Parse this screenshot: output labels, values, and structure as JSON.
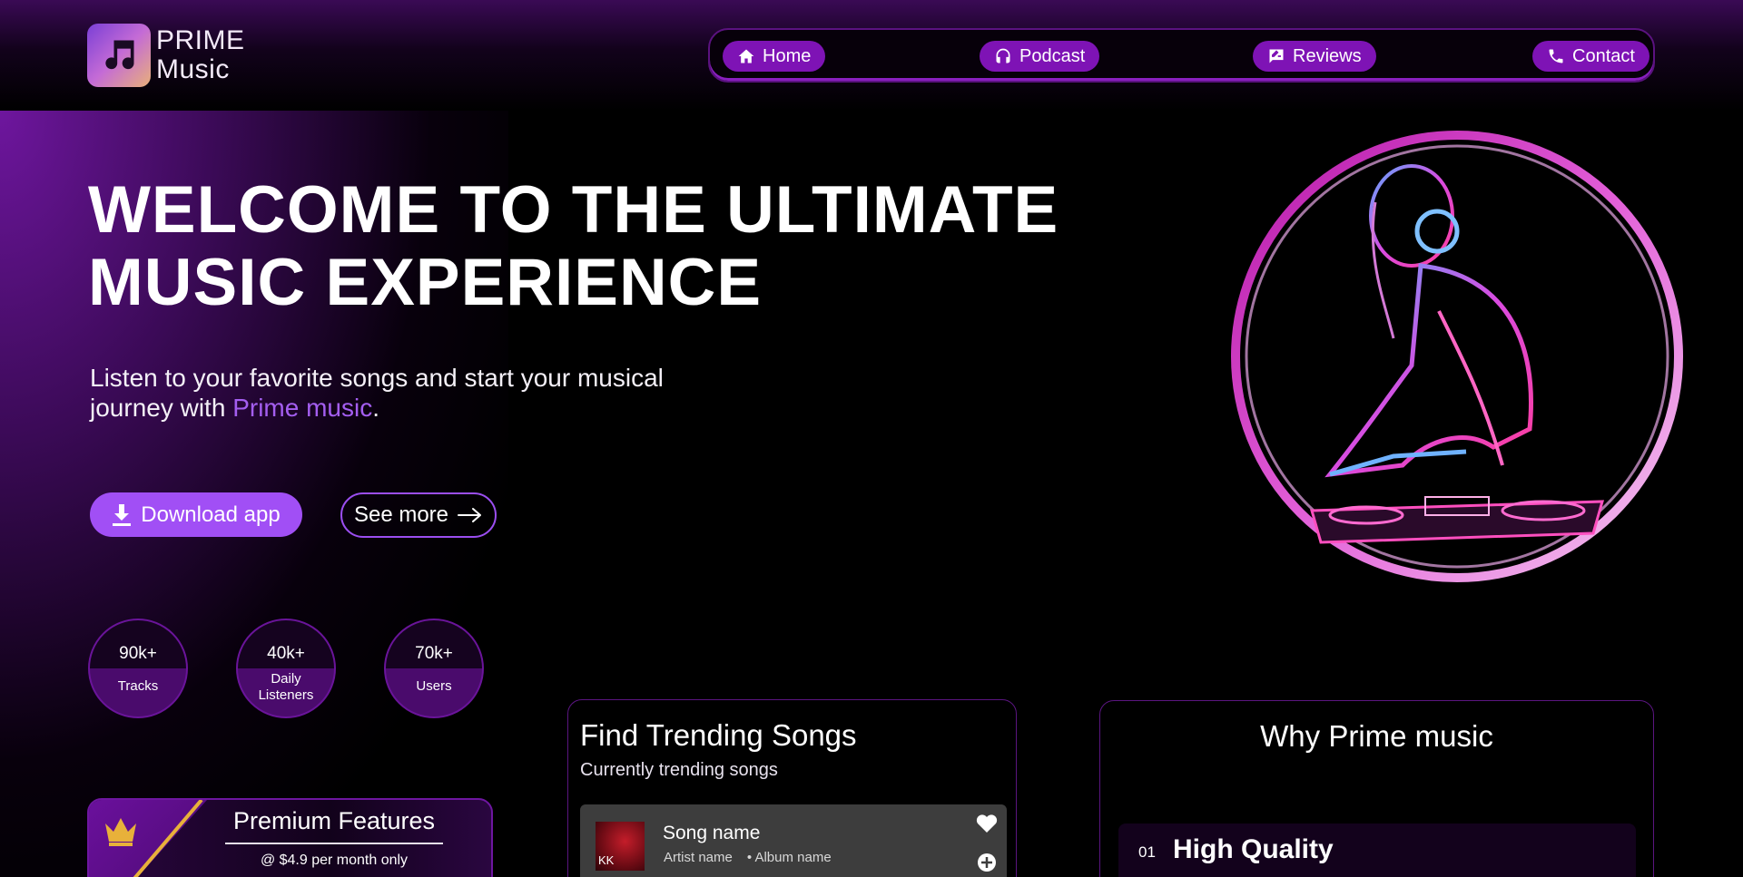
{
  "brand": {
    "line1": "PRIME",
    "line2": "Music"
  },
  "nav": [
    {
      "label": "Home",
      "icon": "home-icon"
    },
    {
      "label": "Podcast",
      "icon": "headphones-icon"
    },
    {
      "label": "Reviews",
      "icon": "review-icon"
    },
    {
      "label": "Contact",
      "icon": "phone-icon"
    }
  ],
  "hero": {
    "title_line1": "WELCOME TO THE ULTIMATE",
    "title_line2": "MUSIC EXPERIENCE",
    "subtitle_line1": "Listen to your favorite songs and start your musical",
    "subtitle_line2_prefix": "journey with ",
    "subtitle_accent": "Prime music",
    "subtitle_suffix": ".",
    "download_label": "Download app",
    "see_more_label": "See more"
  },
  "stats": [
    {
      "value": "90k+",
      "label": "Tracks"
    },
    {
      "value": "40k+",
      "label_line1": "Daily",
      "label_line2": "Listeners"
    },
    {
      "value": "70k+",
      "label": "Users"
    }
  ],
  "premium": {
    "title": "Premium Features",
    "price": "@ $4.9 per month only"
  },
  "trending": {
    "title": "Find Trending Songs",
    "subtitle": "Currently trending songs",
    "song": {
      "name": "Song name",
      "artist": "Artist name",
      "album": "Album name",
      "art_text": "KK"
    }
  },
  "why": {
    "title": "Why Prime music",
    "feature": {
      "number": "01",
      "name": "High Quality"
    }
  },
  "colors": {
    "accent": "#a14ff5",
    "nav_pill": "#7e13b5",
    "accent_text": "#a45ef0"
  }
}
